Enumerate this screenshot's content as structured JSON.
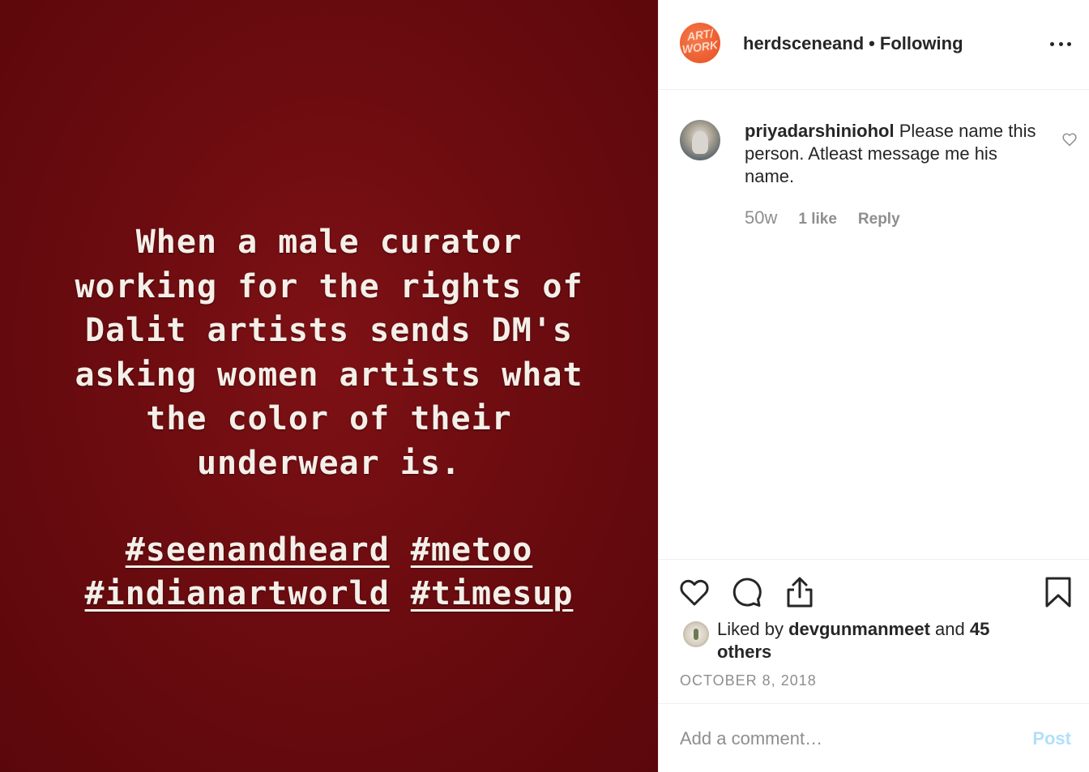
{
  "post": {
    "image_text_lines": [
      "When a male curator",
      "working for the rights of",
      "Dalit artists sends DM's",
      "asking women artists what",
      "the color of their",
      "underwear is."
    ],
    "hashtags_row1": [
      "#seenandheard",
      "#metoo"
    ],
    "hashtags_row2": [
      "#indianartworld",
      "#timesup"
    ],
    "background_color": "#6c0c10"
  },
  "header": {
    "avatar_text_line1": "ART/",
    "avatar_text_line2": "WORK",
    "username": "herdsceneand",
    "separator": "•",
    "follow_status": "Following",
    "more_icon": "more-horizontal-icon"
  },
  "comment": {
    "username": "priyadarshiniohol",
    "text": "Please name this person. Atleast message me his name.",
    "age": "50w",
    "likes": "1 like",
    "reply_label": "Reply",
    "like_icon": "heart-outline-icon"
  },
  "actions": {
    "icons": [
      "heart-icon",
      "comment-icon",
      "share-icon",
      "bookmark-icon"
    ],
    "liked_by_prefix": "Liked by",
    "liked_by_user": "devgunmanmeet",
    "liked_by_and": "and",
    "liked_by_others": "45 others",
    "date": "OCTOBER 8, 2018"
  },
  "add_comment": {
    "placeholder": "Add a comment…",
    "post_label": "Post",
    "post_color": "#b2dffc"
  }
}
